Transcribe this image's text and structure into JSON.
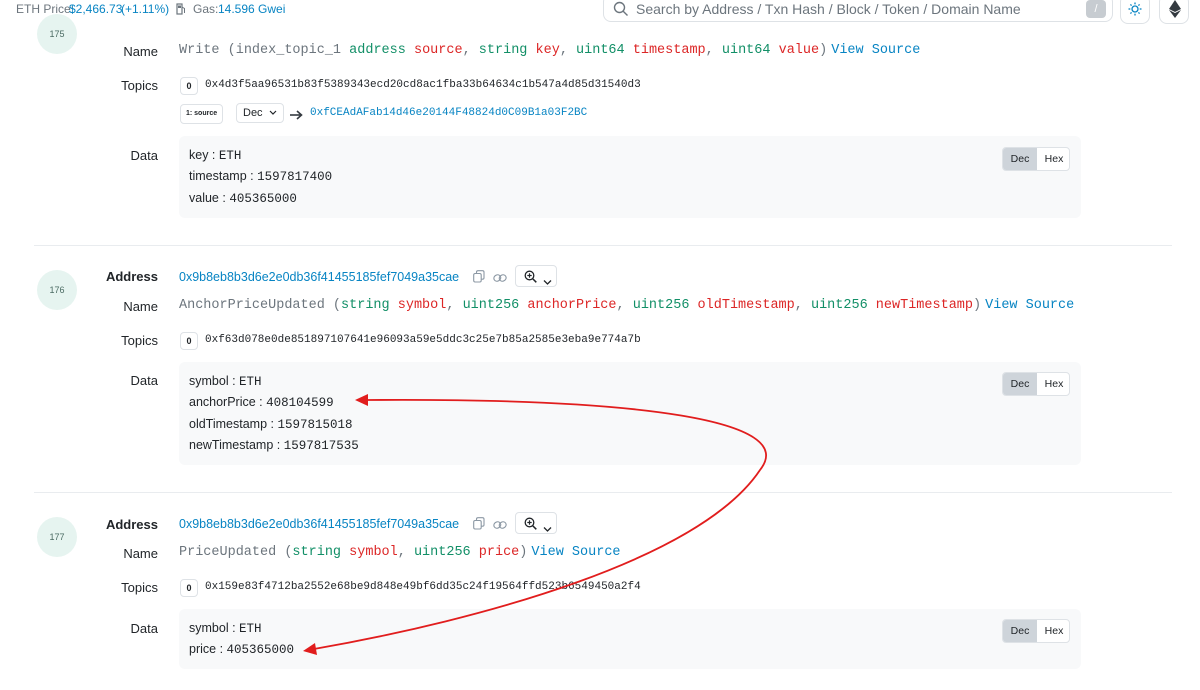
{
  "topbar": {
    "eth_price_label": "ETH Price:",
    "eth_price_value": "$2,466.73",
    "eth_price_change": "(+1.11%)",
    "gas_label": "Gas:",
    "gas_value": "14.596 Gwei",
    "search_placeholder": "Search by Address / Txn Hash / Block / Token / Domain Name",
    "search_shortcut": "/"
  },
  "labels": {
    "address": "Address",
    "name": "Name",
    "topics": "Topics",
    "data": "Data",
    "view_source": "View Source",
    "dec": "Dec",
    "hex": "Hex"
  },
  "logs": [
    {
      "index": "175",
      "event": "Write",
      "params": [
        {
          "prefix": "index_topic_1",
          "type": "address",
          "name": "source"
        },
        {
          "type": "string",
          "name": "key"
        },
        {
          "type": "uint64",
          "name": "timestamp"
        },
        {
          "type": "uint64",
          "name": "value"
        }
      ],
      "topics": [
        {
          "idx": "0",
          "value": "0x4d3f5aa96531b83f5389343ecd20cd8ac1fba33b64634c1b547a4d85d31540d3"
        }
      ],
      "topic1_label": "1: source",
      "topic1_format": "Dec",
      "topic1_value": "0xfCEAdAFab14d46e20144F48824d0C09B1a03F2BC",
      "data": [
        {
          "key": "key",
          "value": "ETH"
        },
        {
          "key": "timestamp",
          "value": "1597817400"
        },
        {
          "key": "value",
          "value": "405365000"
        }
      ]
    },
    {
      "index": "176",
      "address": "0x9b8eb8b3d6e2e0db36f41455185fef7049a35cae",
      "event": "AnchorPriceUpdated",
      "params": [
        {
          "type": "string",
          "name": "symbol"
        },
        {
          "type": "uint256",
          "name": "anchorPrice"
        },
        {
          "type": "uint256",
          "name": "oldTimestamp"
        },
        {
          "type": "uint256",
          "name": "newTimestamp"
        }
      ],
      "topics": [
        {
          "idx": "0",
          "value": "0xf63d078e0de851897107641e96093a59e5ddc3c25e7b85a2585e3eba9e774a7b"
        }
      ],
      "data": [
        {
          "key": "symbol",
          "value": "ETH"
        },
        {
          "key": "anchorPrice",
          "value": "408104599"
        },
        {
          "key": "oldTimestamp",
          "value": "1597815018"
        },
        {
          "key": "newTimestamp",
          "value": "1597817535"
        }
      ]
    },
    {
      "index": "177",
      "address": "0x9b8eb8b3d6e2e0db36f41455185fef7049a35cae",
      "event": "PriceUpdated",
      "params": [
        {
          "type": "string",
          "name": "symbol"
        },
        {
          "type": "uint256",
          "name": "price"
        }
      ],
      "topics": [
        {
          "idx": "0",
          "value": "0x159e83f4712ba2552e68be9d848e49bf6dd35c24f19564ffd523b6549450a2f4"
        }
      ],
      "data": [
        {
          "key": "symbol",
          "value": "ETH"
        },
        {
          "key": "price",
          "value": "405365000"
        }
      ]
    }
  ],
  "colors": {
    "accent": "#0784c3",
    "type": "#128f67",
    "param": "#dc2626",
    "annotation_arrow": "#e11d1d"
  }
}
